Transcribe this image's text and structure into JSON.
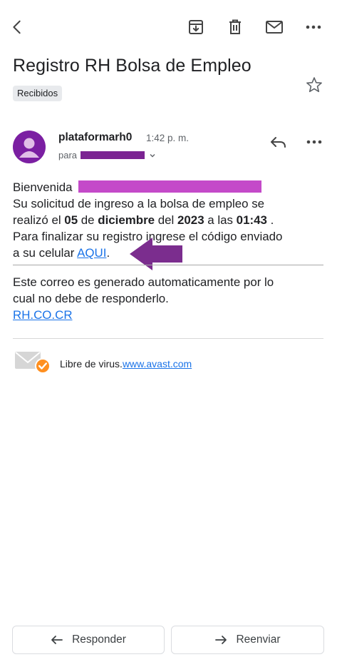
{
  "topbar": {
    "back_icon": "back-arrow-icon",
    "archive_icon": "archive-icon",
    "delete_icon": "trash-icon",
    "mark_unread_icon": "mail-icon",
    "more_icon": "more-horizontal-icon"
  },
  "email": {
    "subject": "Registro RH Bolsa de Empleo",
    "label": "Recibidos",
    "sender": "plataformarh0",
    "time": "1:42 p. m.",
    "to_prefix": "para",
    "avatar_color": "#7b1fa2",
    "body": {
      "greeting": "Bienvenida",
      "line2": "Su solicitud de ingreso a la bolsa de empleo se",
      "line3_a": "realizó el ",
      "day": "05",
      "line3_b": " de ",
      "month": "diciembre",
      "line3_c": " del ",
      "year": "2023",
      "line3_d": " a las ",
      "hour": "01:43",
      "line3_e": " .",
      "line4": "Para finalizar su registro ingrese el código enviado",
      "line5_prefix": "a su celular ",
      "link_text": "AQUI",
      "line5_suffix": "."
    },
    "footer": {
      "line1": "Este correo es generado automaticamente por lo",
      "line2": "cual no debe de responderlo.",
      "link": "RH.CO.CR"
    },
    "signature": {
      "text": "Libre de virus.",
      "link": "www.avast.com"
    }
  },
  "actions": {
    "reply_label": "Responder",
    "forward_label": "Reenviar"
  },
  "colors": {
    "redaction_purple": "#7b2392",
    "redaction_magenta": "#c44ac9",
    "arrow_purple": "#7b2d8e",
    "link_blue": "#1a73e8"
  }
}
